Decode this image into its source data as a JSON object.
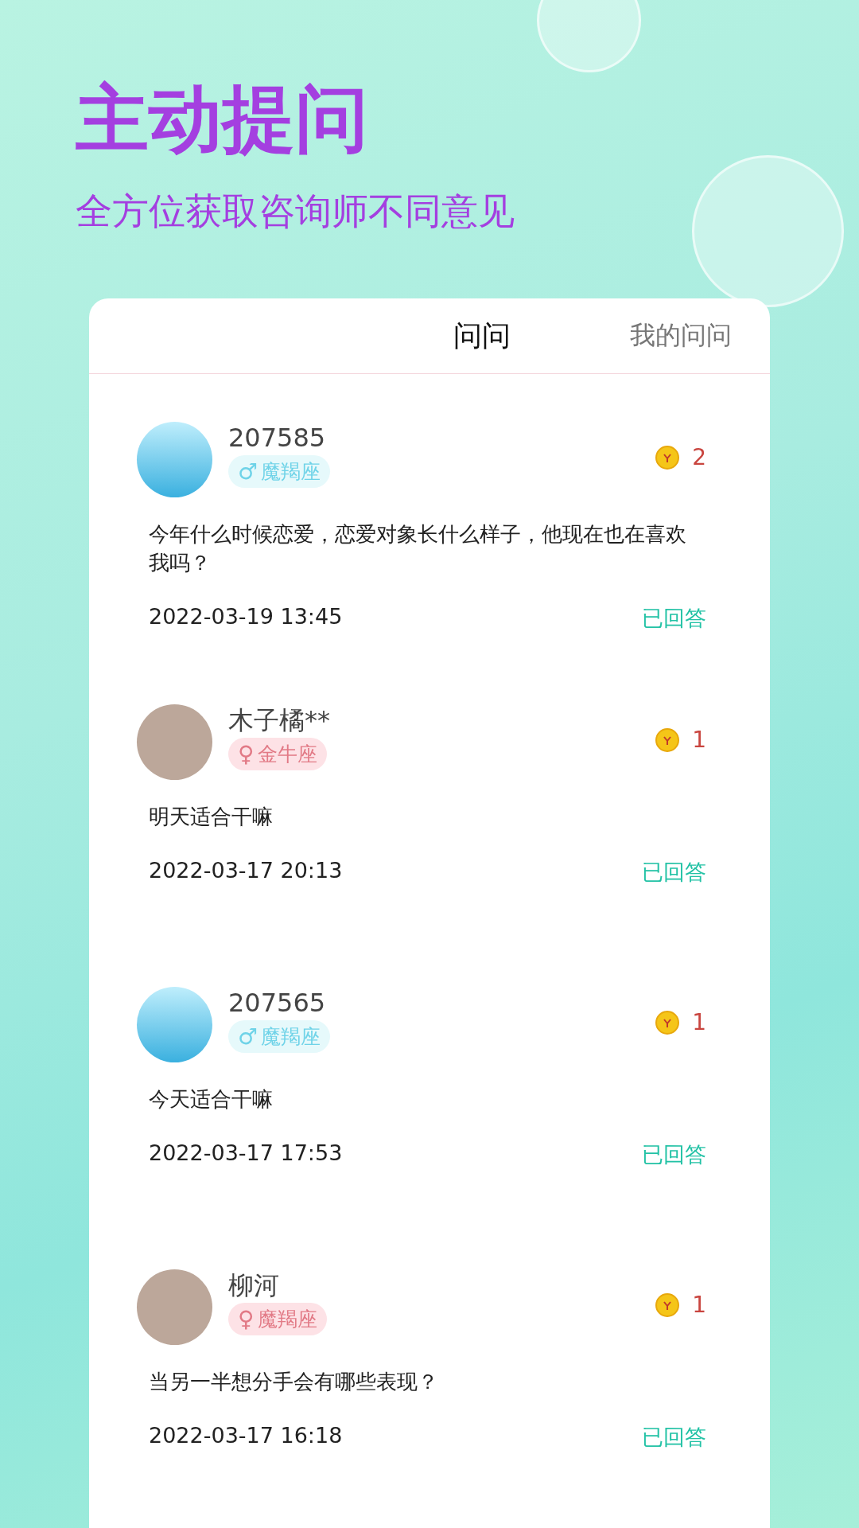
{
  "headline": "主动提问",
  "subheadline": "全方位获取咨询师不同意见",
  "tabs": [
    {
      "label": "问问",
      "selected": true
    },
    {
      "label": "我的问问",
      "selected": false
    }
  ],
  "questions": [
    {
      "name": "207585",
      "kind": "male",
      "gender": "♂",
      "sign": "魔羯座",
      "coins": "2",
      "text": "今年什么时候恋爱，恋爱对象长什么样子，他现在也在喜欢我吗？",
      "time": "2022-03-19 13:45",
      "status": "已回答"
    },
    {
      "name": "木子橘**",
      "kind": "female",
      "gender": "♀",
      "sign": "金牛座",
      "coins": "1",
      "text": "明天适合干嘛",
      "time": "2022-03-17 20:13",
      "status": "已回答"
    },
    {
      "name": "207565",
      "kind": "male",
      "gender": "♂",
      "sign": "魔羯座",
      "coins": "1",
      "text": "今天适合干嘛",
      "time": "2022-03-17 17:53",
      "status": "已回答"
    },
    {
      "name": "柳河",
      "kind": "female",
      "gender": "♀",
      "sign": "魔羯座",
      "coins": "1",
      "text": "当另一半想分手会有哪些表现？",
      "time": "2022-03-17 16:18",
      "status": "已回答"
    }
  ]
}
